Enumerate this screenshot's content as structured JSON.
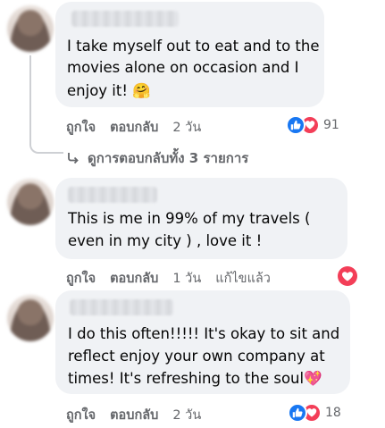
{
  "comments": [
    {
      "lines": [
        "I take myself out to eat and to the",
        "movies alone on occasion and I",
        "enjoy it! 🤗"
      ],
      "like_label": "ถูกใจ",
      "reply_label": "ตอบกลับ",
      "time": "2 วัน",
      "reaction_count": "91",
      "replies_link": "ดูการตอบกลับทั้ง 3 รายการ"
    },
    {
      "lines": [
        "This is me in 99% of my travels (",
        "even in my city ) , love it !"
      ],
      "like_label": "ถูกใจ",
      "reply_label": "ตอบกลับ",
      "time": "1 วัน",
      "edited_label": "แก้ไขแล้ว"
    },
    {
      "lines": [
        "I do this often!!!!! It's okay to sit and",
        "reflect enjoy your own company at",
        "times! It's refreshing to the soul💖"
      ],
      "like_label": "ถูกใจ",
      "reply_label": "ตอบกลับ",
      "time": "2 วัน",
      "reaction_count": "18"
    }
  ],
  "colors": {
    "like": "#1877f2",
    "love": "#f33e58",
    "bubble": "#f0f2f5",
    "meta": "#65676b"
  },
  "icons": {
    "like": "thumbs-up-icon",
    "love": "heart-icon",
    "reply_arrow": "reply-arrow-icon"
  }
}
